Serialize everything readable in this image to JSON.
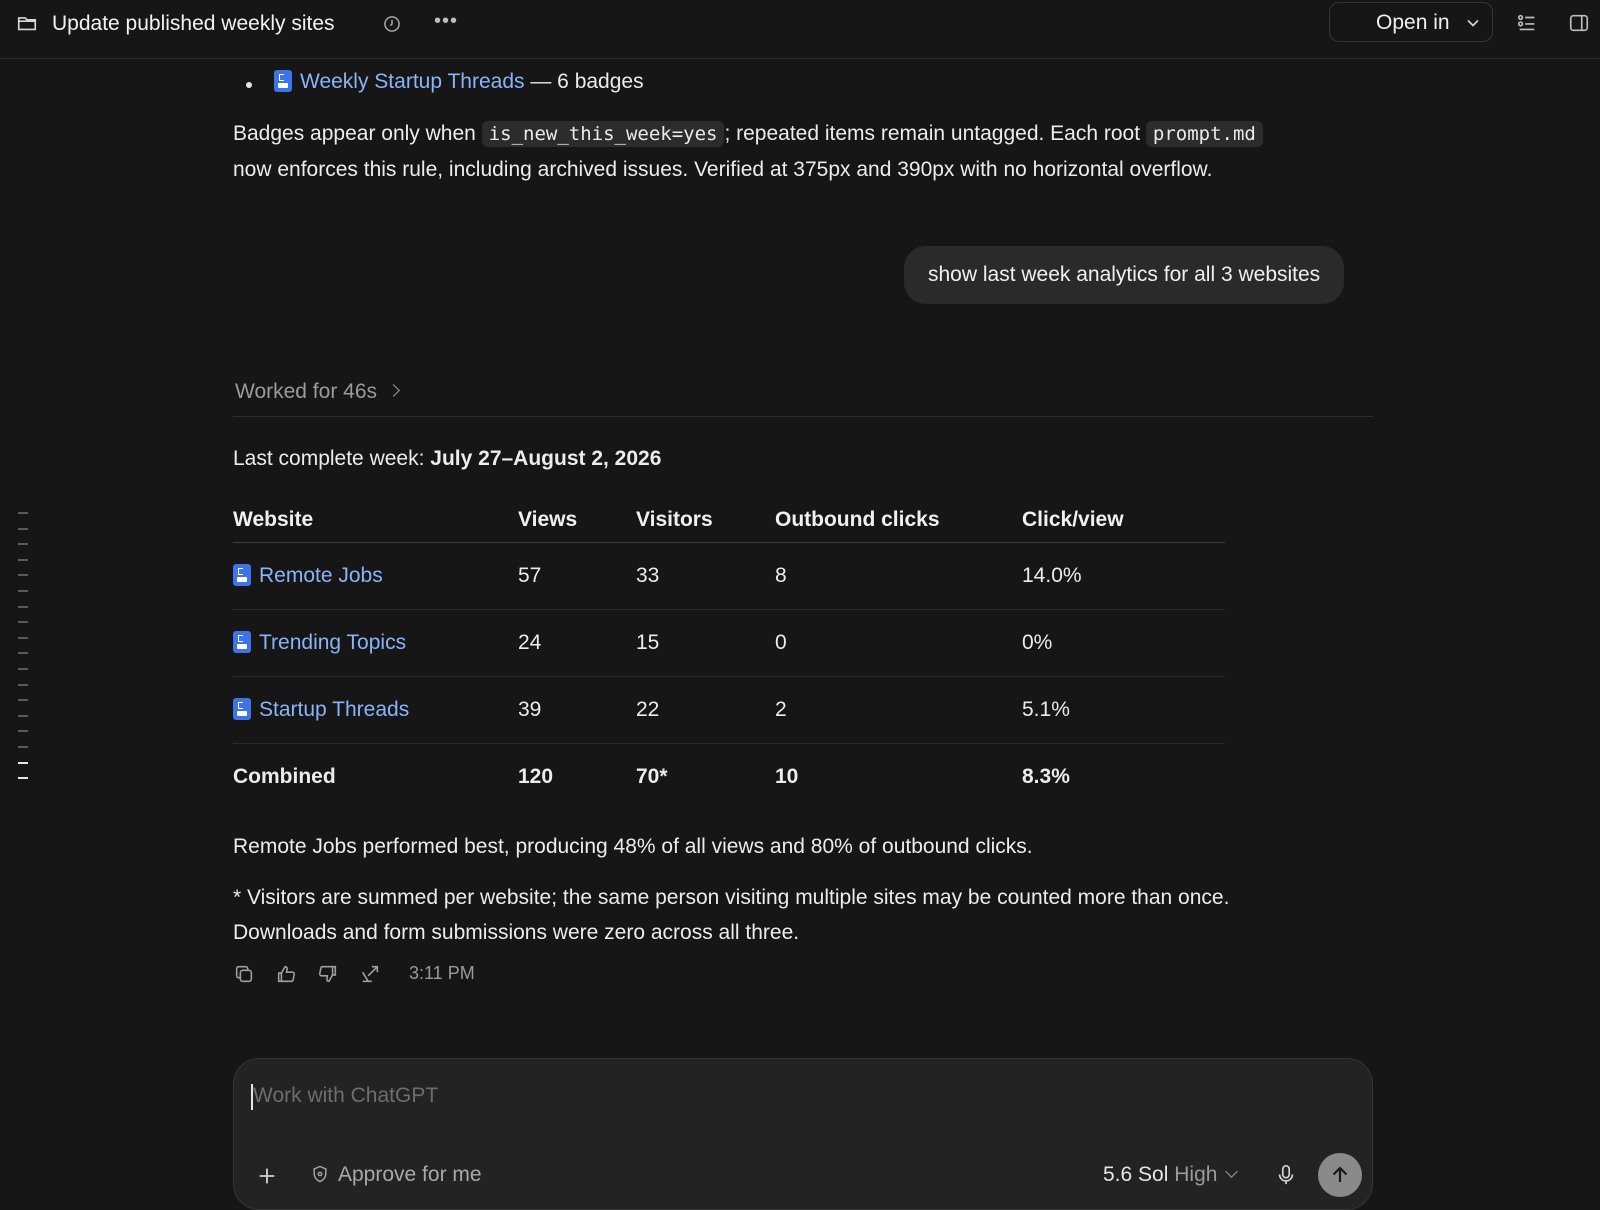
{
  "header": {
    "title": "Update published weekly sites",
    "open_in_label": "Open in"
  },
  "thread": {
    "prev_bullet": {
      "link": "Weekly Startup Threads",
      "suffix": "— 6 badges"
    },
    "badges_note": {
      "part1": "Badges appear only when ",
      "code1": "is_new_this_week=yes",
      "part2": "; repeated items remain untagged. Each root ",
      "code2": "prompt.md",
      "part3": "now enforces this rule, including archived issues. Verified at 375px and 390px with no horizontal overflow."
    },
    "user_message": "show last week analytics for all 3 websites",
    "worked_label": "Worked for 46s",
    "week_label": "Last complete week:",
    "week_range": "July 27–August 2, 2026",
    "table": {
      "headers": [
        "Website",
        "Views",
        "Visitors",
        "Outbound clicks",
        "Click/view"
      ],
      "rows": [
        {
          "site": "Remote Jobs",
          "views": "57",
          "visitors": "33",
          "clicks": "8",
          "ctr": "14.0%"
        },
        {
          "site": "Trending Topics",
          "views": "24",
          "visitors": "15",
          "clicks": "0",
          "ctr": "0%"
        },
        {
          "site": "Startup Threads",
          "views": "39",
          "visitors": "22",
          "clicks": "2",
          "ctr": "5.1%"
        }
      ],
      "combined": {
        "site": "Combined",
        "views": "120",
        "visitors": "70*",
        "clicks": "10",
        "ctr": "8.3%"
      }
    },
    "summary": "Remote Jobs performed best, producing 48% of all views and 80% of outbound clicks.",
    "footnote1": "* Visitors are summed per website; the same person visiting multiple sites may be counted more than once.",
    "footnote2": "Downloads and form submissions were zero across all three.",
    "timestamp": "3:11 PM"
  },
  "composer": {
    "placeholder": "Work with ChatGPT",
    "approve_label": "Approve for me",
    "model": "5.6 Sol",
    "level": "High"
  },
  "icons": {
    "folder": "folder-icon",
    "history": "history-icon",
    "more": "more-icon",
    "chevron": "chevron-down-icon",
    "list": "list-icon",
    "panel": "panel-icon",
    "site": "site-doc-icon",
    "copy": "copy-icon",
    "thumbs_up": "thumbs-up-icon",
    "thumbs_down": "thumbs-down-icon",
    "share": "share-icon",
    "plus": "plus-icon",
    "shield": "shield-icon",
    "mic": "mic-icon",
    "send": "arrow-up-icon"
  },
  "colors": {
    "background": "#161616",
    "link": "#8ab4f8",
    "site_icon": "#3d74ea"
  }
}
